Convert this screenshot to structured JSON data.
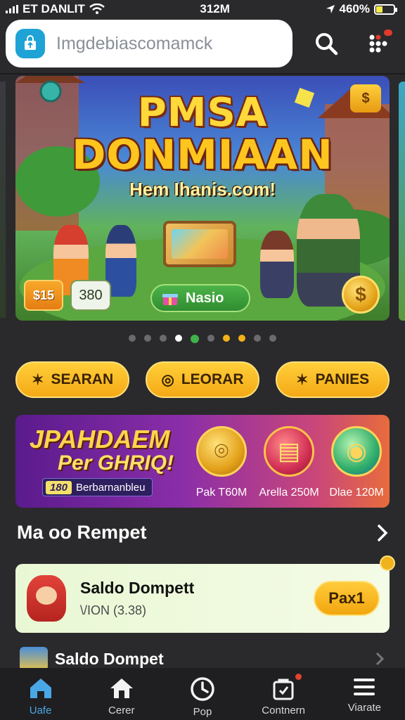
{
  "status_bar": {
    "carrier": "ET DANLIT",
    "time": "312M",
    "battery": "460%"
  },
  "search": {
    "value": "Imgdebiascomamck"
  },
  "banner": {
    "title_line1": "PMSA",
    "title_line2": "DONMIAAN",
    "subtitle": "Hem Ihanis.com!",
    "chip_left": "$15",
    "chip_right": "380",
    "pill_label": "Nasio",
    "coin_symbol": "$",
    "gem_symbol": "$"
  },
  "carousel": {
    "count": 10,
    "active_index": 4,
    "colors": [
      "#6b6b6f",
      "#6b6b6f",
      "#6b6b6f",
      "#ffffff",
      "#3fb24a",
      "#6b6b6f",
      "#f2b218",
      "#f2b218",
      "#6b6b6f",
      "#6b6b6f"
    ]
  },
  "categories": [
    {
      "label": "SEARAN",
      "icon": "sparkle-icon"
    },
    {
      "label": "LEORAR",
      "icon": "coin-icon"
    },
    {
      "label": "PANIES",
      "icon": "sparkle-icon"
    }
  ],
  "promo": {
    "title_line1": "JPAHDAEM",
    "title_line2": "Per GHRIQ!",
    "tag_number": "180",
    "tag_text": "Berbarnanbleu",
    "items": [
      {
        "label": "Pak T60M"
      },
      {
        "label": "Arella 250M"
      },
      {
        "label": "Dlae 120M"
      }
    ]
  },
  "section": {
    "title": "Ma oo Rempet"
  },
  "wallet": {
    "title": "Saldo Dompett",
    "subtitle": "\\/ION (3.38)",
    "button_label": "Pax1"
  },
  "wallet_row2": {
    "title": "Saldo Dompet"
  },
  "tabs": [
    {
      "label": "Uafe",
      "icon": "home-icon",
      "active": true
    },
    {
      "label": "Cerer",
      "icon": "house-icon",
      "active": false
    },
    {
      "label": "Pop",
      "icon": "clock-icon",
      "active": false
    },
    {
      "label": "Contnern",
      "icon": "bag-icon",
      "active": false,
      "badge": true
    },
    {
      "label": "Viarate",
      "icon": "menu-icon",
      "active": false
    }
  ],
  "colors": {
    "accent_yellow": "#f4a915",
    "tab_active": "#4aa7e6",
    "background": "#2a2a2c"
  }
}
